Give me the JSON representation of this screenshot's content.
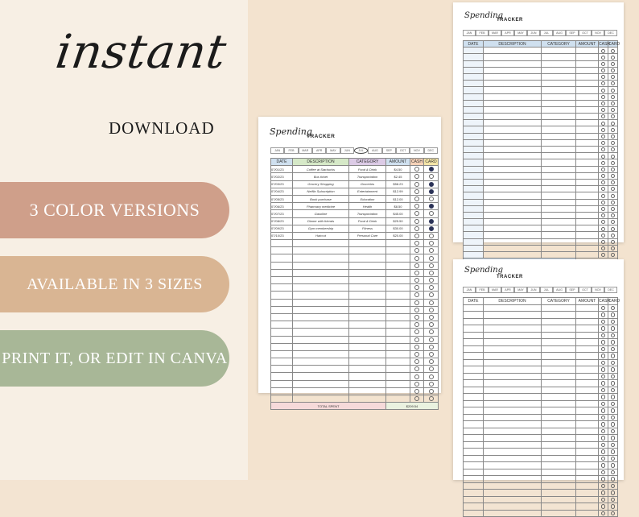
{
  "left": {
    "script_title": "instant",
    "download": "DOWNLOAD",
    "pills": [
      "3 COLOR VERSIONS",
      "AVAILABLE IN 3 SIZES",
      "PRINT IT, OR EDIT IN CANVA"
    ]
  },
  "tracker": {
    "brand_script": "Spending",
    "brand_word": "TRACKER",
    "months": [
      "JAN",
      "FEB",
      "MAR",
      "APR",
      "MAY",
      "JUN",
      "JUL",
      "AUG",
      "SEP",
      "OCT",
      "NOV",
      "DEC"
    ],
    "headers": [
      "DATE",
      "DESCRIPTION",
      "CATEGORY",
      "AMOUNT",
      "CASH",
      "CARD"
    ],
    "total_label": "TOTAL SPENT",
    "total_value": "$209.54",
    "rows": [
      {
        "date": "07/01/23",
        "desc": "Coffee at Starbucks",
        "cat": "Food & Drink",
        "amt": "$4.50",
        "card": true
      },
      {
        "date": "07/02/23",
        "desc": "Bus ticket",
        "cat": "Transportation",
        "amt": "$2.45",
        "card": false
      },
      {
        "date": "07/03/23",
        "desc": "Grocery Shopping",
        "cat": "Groceries",
        "amt": "$58.23",
        "card": true
      },
      {
        "date": "07/04/23",
        "desc": "Netflix Subscription",
        "cat": "Entertainment",
        "amt": "$12.99",
        "card": true
      },
      {
        "date": "07/05/23",
        "desc": "Book purchase",
        "cat": "Education",
        "amt": "$12.00",
        "card": false
      },
      {
        "date": "07/06/23",
        "desc": "Pharmacy medicine",
        "cat": "Health",
        "amt": "$8.50",
        "card": true
      },
      {
        "date": "07/07/23",
        "desc": "Gasoline",
        "cat": "Transportation",
        "amt": "$45.00",
        "card": false
      },
      {
        "date": "07/08/23",
        "desc": "Dinner with friends",
        "cat": "Food & Drink",
        "amt": "$25.50",
        "card": true
      },
      {
        "date": "07/09/23",
        "desc": "Gym membership",
        "cat": "Fitness",
        "amt": "$30.00",
        "card": true
      },
      {
        "date": "07/10/23",
        "desc": "Haircut",
        "cat": "Personal Care",
        "amt": "$20.00",
        "card": false
      }
    ]
  },
  "colors": {
    "pill_rose": "#cf9f8a",
    "pill_tan": "#d9b593",
    "pill_sage": "#a8b797",
    "hdr_blue": "#cfe0ef",
    "hdr_green": "#d6e9c8",
    "hdr_purple": "#dccbe6",
    "hdr_orange": "#f6d2b8",
    "hdr_yellow": "#f4e5a8",
    "fill_navy": "#2b3257"
  }
}
